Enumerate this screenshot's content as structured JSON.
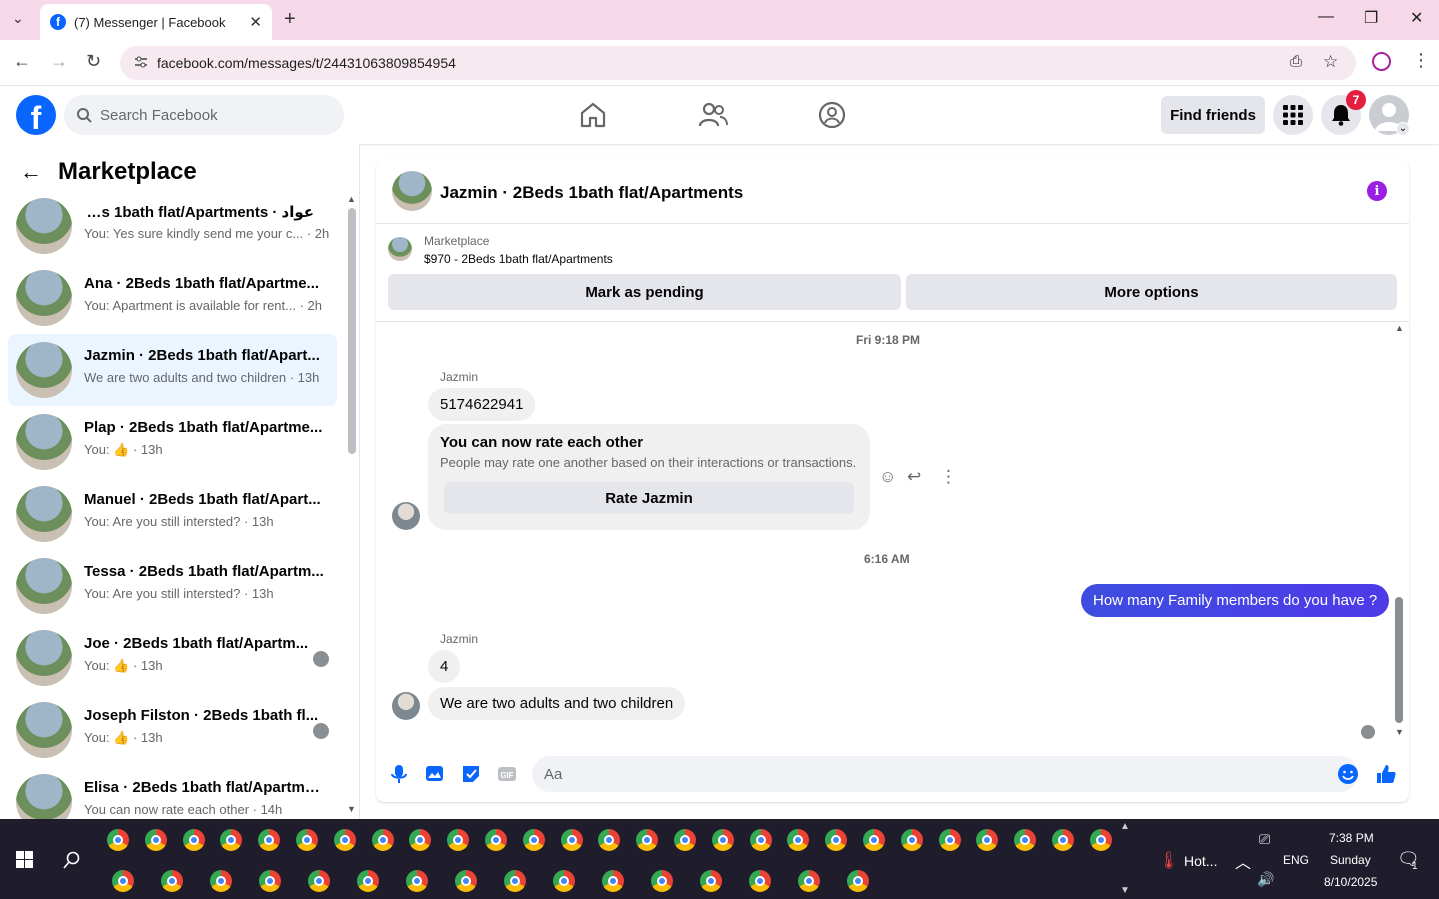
{
  "browser": {
    "tab_title": "(7) Messenger | Facebook",
    "url": "facebook.com/messages/t/24431063809854954"
  },
  "fb": {
    "search_placeholder": "Search Facebook",
    "find_friends": "Find friends",
    "notification_count": "7",
    "logo_letter": "f"
  },
  "sidebar": {
    "title": "Marketplace",
    "conversations": [
      {
        "name": "عواد · 2Beds 1bath flat/Apartments",
        "preview": "You: Yes sure kindly send me your c... · 2h",
        "active": false
      },
      {
        "name": "Ana · 2Beds 1bath flat/Apartme...",
        "preview": "You: Apartment is available for rent... · 2h",
        "active": false
      },
      {
        "name": "Jazmin · 2Beds 1bath flat/Apart...",
        "preview": "We are two adults and two children · 13h",
        "active": true
      },
      {
        "name": "Plap · 2Beds 1bath flat/Apartme...",
        "preview": "You: 👍 · 13h",
        "active": false
      },
      {
        "name": "Manuel · 2Beds 1bath flat/Apart...",
        "preview": "You: Are you still intersted? · 13h",
        "active": false
      },
      {
        "name": "Tessa · 2Beds 1bath flat/Apartm...",
        "preview": "You: Are you still intersted? · 13h",
        "active": false
      },
      {
        "name": "Joe · 2Beds 1bath flat/Apartm...",
        "preview": "You: 👍 · 13h",
        "active": false
      },
      {
        "name": "Joseph Filston · 2Beds 1bath fl...",
        "preview": "You: 👍 · 13h",
        "active": false
      },
      {
        "name": "Elisa · 2Beds 1bath flat/Apartme...",
        "preview": "You can now rate each other · 14h",
        "active": false
      }
    ]
  },
  "chat": {
    "title": "Jazmin · 2Beds 1bath flat/Apartments",
    "listing_source": "Marketplace",
    "listing_title": "$970 - 2Beds 1bath flat/Apartments",
    "mark_pending": "Mark as pending",
    "more_options": "More options",
    "timestamp1": "Fri 9:18 PM",
    "sender1": "Jazmin",
    "msg_phone": "5174622941",
    "rate_title": "You can now rate each other",
    "rate_sub": "People may rate one another based on their interactions or transactions.",
    "rate_button": "Rate Jazmin",
    "timestamp2": "6:16 AM",
    "msg_mine": "How many Family members do you have ?",
    "sender2": "Jazmin",
    "msg_four": "4",
    "msg_last": "We are two adults and two children",
    "composer_placeholder": "Aa"
  },
  "taskbar": {
    "weather": "Hot...",
    "lang": "ENG",
    "time": "7:38 PM",
    "day": "Sunday",
    "date": "8/10/2025",
    "notif": "1"
  },
  "colors": {
    "fb_blue": "#0866ff",
    "my_bubble": "#4a3ee6",
    "tab_strip": "#f7d8e8",
    "taskbar": "#1f1d2b"
  }
}
